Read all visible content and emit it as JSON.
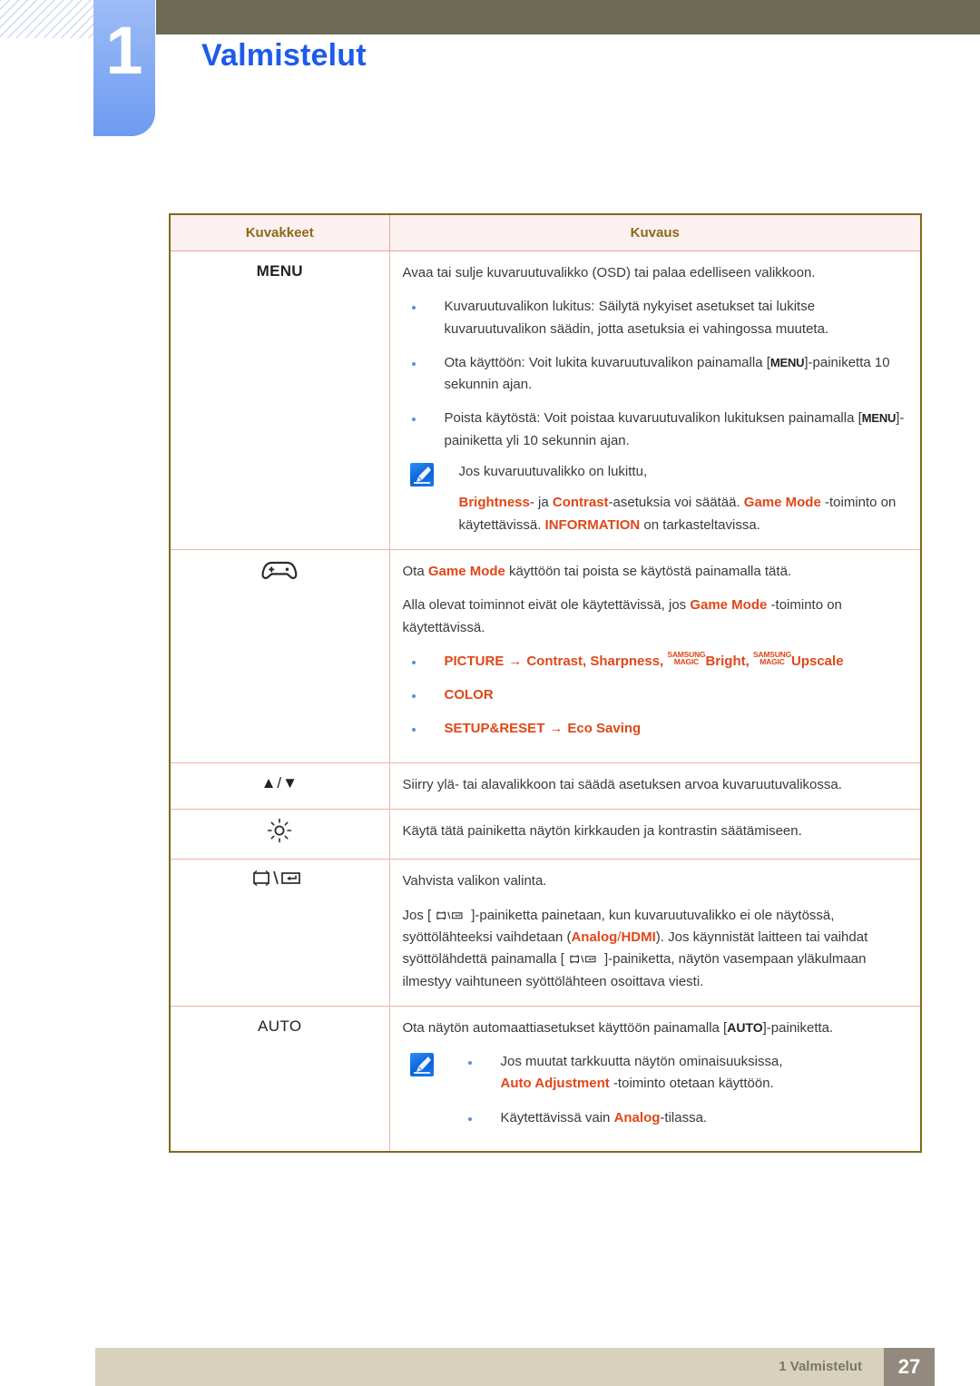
{
  "header": {
    "chapter_number": "1",
    "chapter_title": "Valmistelut"
  },
  "table": {
    "columns": [
      "Kuvakkeet",
      "Kuvaus"
    ],
    "rows": [
      {
        "icon_label": "MENU",
        "intro": "Avaa tai sulje kuvaruutuvalikko (OSD) tai palaa edelliseen valikkoon.",
        "bullets": [
          {
            "pre": "Kuvaruutuvalikon lukitus: Säilytä nykyiset asetukset tai lukitse kuvaruutuvalikon säädin, jotta asetuksia ei vahingossa muuteta."
          },
          {
            "pre": "Ota käyttöön: Voit lukita kuvaruutuvalikon painamalla [",
            "key": "MENU",
            "post": "]-painiketta 10 sekunnin ajan."
          },
          {
            "pre": "Poista käytöstä: Voit poistaa kuvaruutuvalikon lukituksen painamalla [",
            "key": "MENU",
            "post": "]-painiketta yli 10 sekunnin ajan."
          }
        ],
        "note": {
          "line1": "Jos kuvaruutuvalikko on lukittu,",
          "seg1": "Brightness",
          "seg2": "- ja ",
          "seg3": "Contrast",
          "seg4": "-asetuksia voi säätää. ",
          "seg5": "Game Mode",
          "seg6": " -toiminto on käytettävissä. ",
          "seg7": "INFORMATION",
          "seg8": " on tarkasteltavissa."
        }
      },
      {
        "icon_name": "gamepad-icon",
        "p1_pre": "Ota ",
        "p1_hl": "Game Mode",
        "p1_post": " käyttöön tai poista se käytöstä painamalla tätä.",
        "p2_pre": "Alla olevat toiminnot eivät ole käytettävissä, jos ",
        "p2_hl": "Game Mode",
        "p2_post": " -toiminto on käytettävissä.",
        "menu_bullets": [
          {
            "head": "PICTURE",
            "arrow": "→",
            "items": "Contrast, Sharpness, ",
            "magic1_top": "SAMSUNG",
            "magic1_bottom": "MAGIC",
            "magic1_word": "Bright",
            "sep": ", ",
            "magic2_top": "SAMSUNG",
            "magic2_bottom": "MAGIC",
            "magic2_word": "Upscale"
          },
          {
            "head": "COLOR"
          },
          {
            "head": "SETUP&RESET",
            "arrow": "→",
            "items": "Eco Saving"
          }
        ]
      },
      {
        "icon_name": "up-down-arrows-icon",
        "icon_label": "▲/▼",
        "text": "Siirry ylä- tai alavalikkoon tai säädä asetuksen arvoa kuvaruutuvalikossa."
      },
      {
        "icon_name": "brightness-sun-icon",
        "text": "Käytä tätä painiketta näytön kirkkauden ja kontrastin säätämiseen."
      },
      {
        "icon_name": "source-enter-icon",
        "p1": "Vahvista valikon valinta.",
        "p2_a": "Jos [",
        "p2_b": "]-painiketta painetaan, kun kuvaruutuvalikko ei ole näytössä, syöttölähteeksi vaihdetaan (",
        "p2_hl1": "Analog",
        "p2_slash": "/",
        "p2_hl2": "HDMI",
        "p2_c": "). Jos käynnistät laitteen tai vaihdat syöttölähdettä painamalla [",
        "p2_d": "]-painiketta, näytön vasempaan yläkulmaan ilmestyy vaihtuneen syöttölähteen osoittava viesti."
      },
      {
        "icon_label": "AUTO",
        "p1_pre": "Ota näytön automaattiasetukset käyttöön painamalla [",
        "p1_key": "AUTO",
        "p1_post": "]-painiketta.",
        "note_bullets": [
          {
            "line1": "Jos muutat tarkkuutta näytön ominaisuuksissa,",
            "hl": "Auto Adjustment",
            "line2": " -toiminto otetaan käyttöön."
          },
          {
            "pre": "Käytettävissä vain ",
            "hl": "Analog",
            "post": "-tilassa."
          }
        ]
      }
    ]
  },
  "footer": {
    "label": "1 Valmistelut",
    "page_number": "27"
  },
  "colors": {
    "accent_orange": "#e04718",
    "chapter_blue": "#1c5bec",
    "olive": "#6d6a55",
    "table_border": "#7e6a1c",
    "table_inner_border": "#efb3a4",
    "header_fill": "#fdf0f0",
    "header_text": "#8a6a18",
    "footer_bar": "#d8d2bd",
    "footer_page_box": "#94897f"
  }
}
